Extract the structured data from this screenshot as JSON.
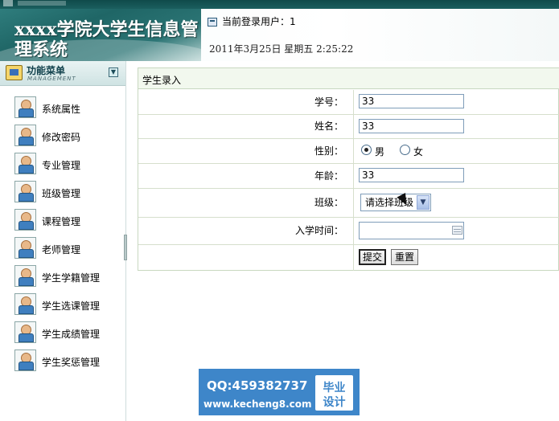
{
  "header": {
    "system_title": "xxxx学院大学生信息管理系统",
    "current_user_label": "当前登录用户：",
    "current_user": "1",
    "datetime": "2011年3月25日  星期五  2:25:22"
  },
  "sidebar": {
    "title": "功能菜单",
    "subtitle": "MANAGEMENT",
    "items": [
      {
        "label": "系统属性"
      },
      {
        "label": "修改密码"
      },
      {
        "label": "专业管理"
      },
      {
        "label": "班级管理"
      },
      {
        "label": "课程管理"
      },
      {
        "label": "老师管理"
      },
      {
        "label": "学生学籍管理"
      },
      {
        "label": "学生选课管理"
      },
      {
        "label": "学生成绩管理"
      },
      {
        "label": "学生奖惩管理"
      }
    ]
  },
  "form": {
    "title": "学生录入",
    "student_id_label": "学号：",
    "student_id_value": "33",
    "name_label": "姓名：",
    "name_value": "33",
    "gender_label": "性别：",
    "gender_male": "男",
    "gender_female": "女",
    "gender_selected": "男",
    "age_label": "年龄：",
    "age_value": "33",
    "class_label": "班级：",
    "class_selected": "请选择班级",
    "enroll_label": "入学时间：",
    "enroll_value": "",
    "submit_label": "提交",
    "reset_label": "重置"
  },
  "watermark": {
    "qq": "QQ:459382737",
    "url": "www.kecheng8.com",
    "badge_line1": "毕业",
    "badge_line2": "设计"
  },
  "colors": {
    "header_dark": "#1f6666",
    "panel_border": "#c8d8c0",
    "watermark_bg": "#3e86c9"
  }
}
